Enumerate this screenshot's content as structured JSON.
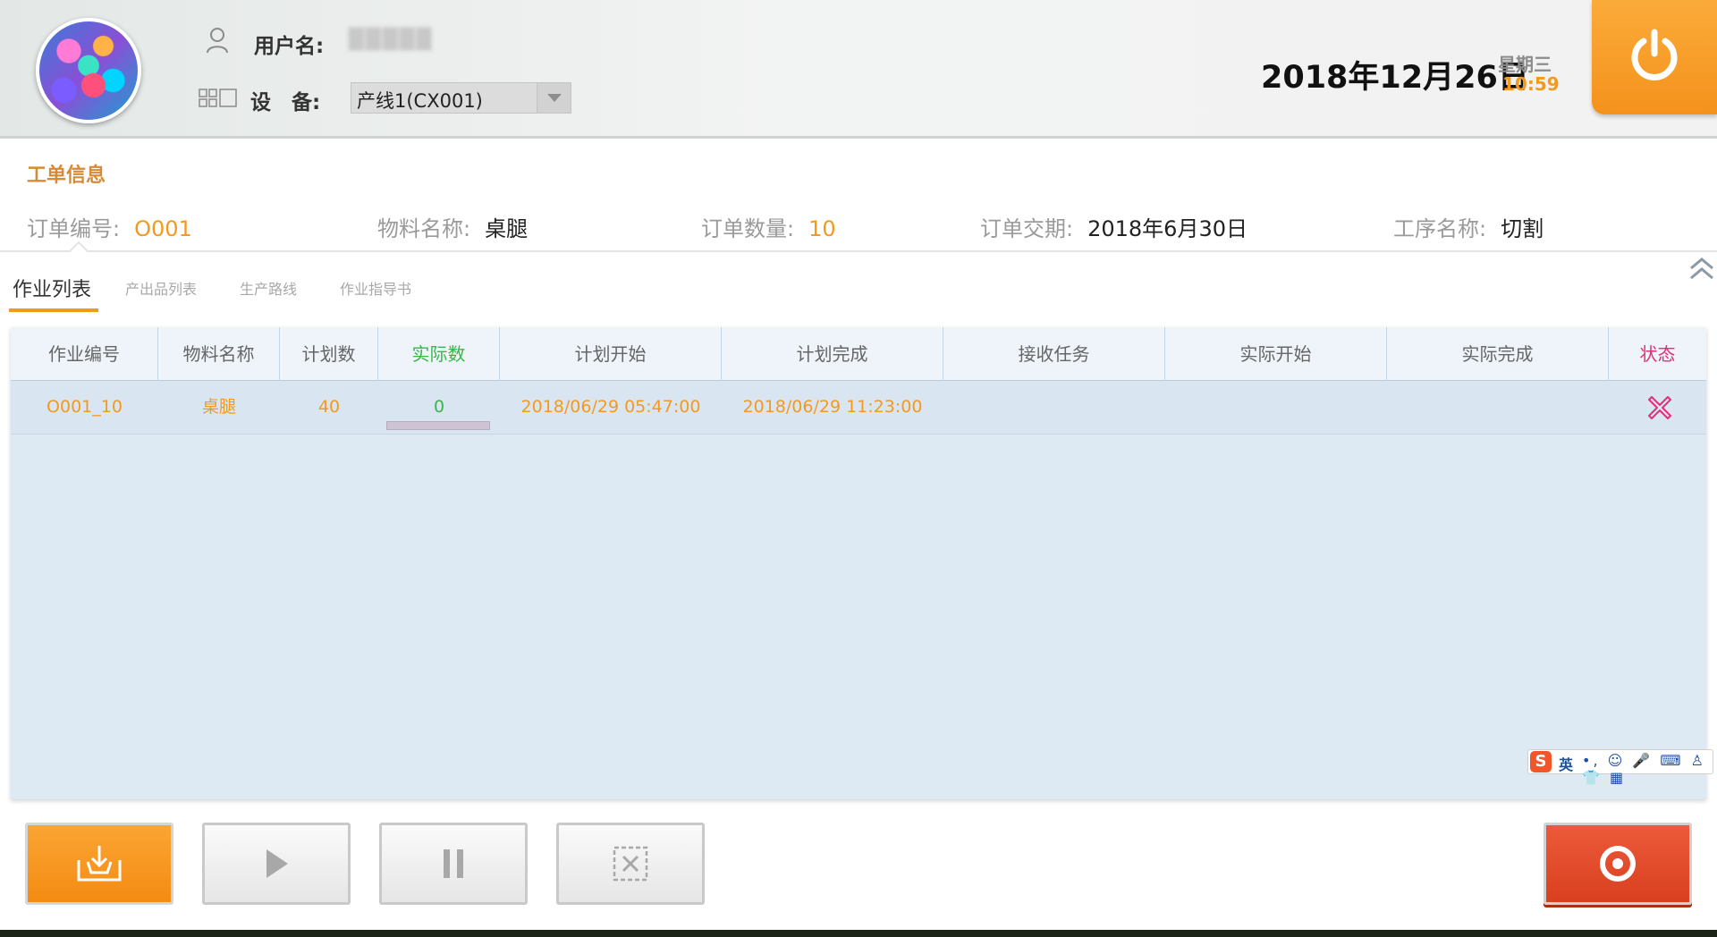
{
  "header": {
    "username_label": "用户名:",
    "username_value": "█████",
    "device_label": "设　备:",
    "device_selected": "产线1(CX001)",
    "date": "2018年12月26日",
    "weekday": "星期三",
    "time": "10:59"
  },
  "work_order": {
    "section_title": "工单信息",
    "order_no_label": "订单编号:",
    "order_no_value": "O001",
    "material_label": "物料名称:",
    "material_value": "桌腿",
    "quantity_label": "订单数量:",
    "quantity_value": "10",
    "due_label": "订单交期:",
    "due_value": "2018年6月30日",
    "process_label": "工序名称:",
    "process_value": "切割"
  },
  "tabs": [
    {
      "label": "作业列表",
      "active": true
    },
    {
      "label": "产出品列表",
      "active": false
    },
    {
      "label": "生产路线",
      "active": false
    },
    {
      "label": "作业指导书",
      "active": false
    }
  ],
  "table": {
    "columns": [
      "作业编号",
      "物料名称",
      "计划数",
      "实际数",
      "计划开始",
      "计划完成",
      "接收任务",
      "实际开始",
      "实际完成",
      "状态"
    ],
    "rows": [
      {
        "job_no": "O001_10",
        "material": "桌腿",
        "planned_qty": "40",
        "actual_qty": "0",
        "planned_start": "2018/06/29 05:47:00",
        "planned_finish": "2018/06/29 11:23:00",
        "received": "",
        "actual_start": "",
        "actual_finish": "",
        "status_icon": "cross-icon",
        "progress_fraction": 0
      }
    ]
  },
  "ime": {
    "logo": "S",
    "lang": "英",
    "tools": "•, ☺ 🎤 ⌨ ♙ 👕 ▦"
  },
  "colors": {
    "accent_orange": "#f39a1e",
    "actual_green": "#39b54a",
    "status_pink": "#e0307a",
    "stop_red": "#e24a2a"
  },
  "toolbar": {
    "buttons": [
      "download-button",
      "start-button",
      "pause-button",
      "cancel-button",
      "stop-button"
    ]
  }
}
